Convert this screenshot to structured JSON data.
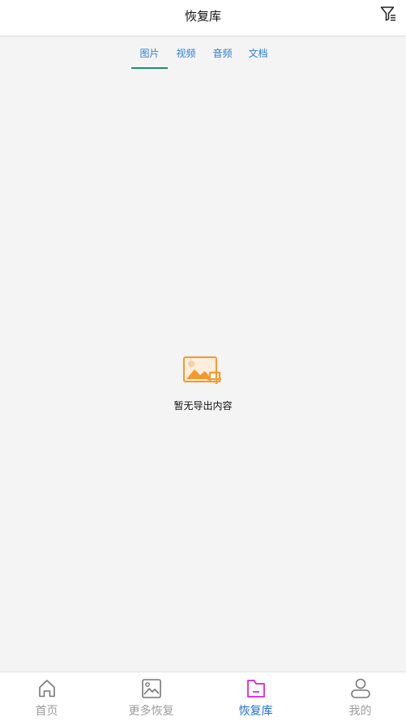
{
  "header": {
    "title": "恢复库",
    "filter_icon": "filter-icon"
  },
  "tabs": [
    {
      "label": "图片",
      "active": true
    },
    {
      "label": "视频",
      "active": false
    },
    {
      "label": "音频",
      "active": false
    },
    {
      "label": "文档",
      "active": false
    }
  ],
  "empty_state": {
    "icon": "image-export-icon",
    "text": "暂无导出内容"
  },
  "bottom_nav": [
    {
      "label": "首页",
      "icon": "home-icon",
      "active": false
    },
    {
      "label": "更多恢复",
      "icon": "image-icon",
      "active": false
    },
    {
      "label": "恢复库",
      "icon": "folder-icon",
      "active": true
    },
    {
      "label": "我的",
      "icon": "user-icon",
      "active": false
    }
  ],
  "colors": {
    "accent_blue": "#1f6fd1",
    "tab_indicator": "#1a8f73",
    "active_icon": "#d020d8",
    "empty_icon": "#f29a2e"
  }
}
